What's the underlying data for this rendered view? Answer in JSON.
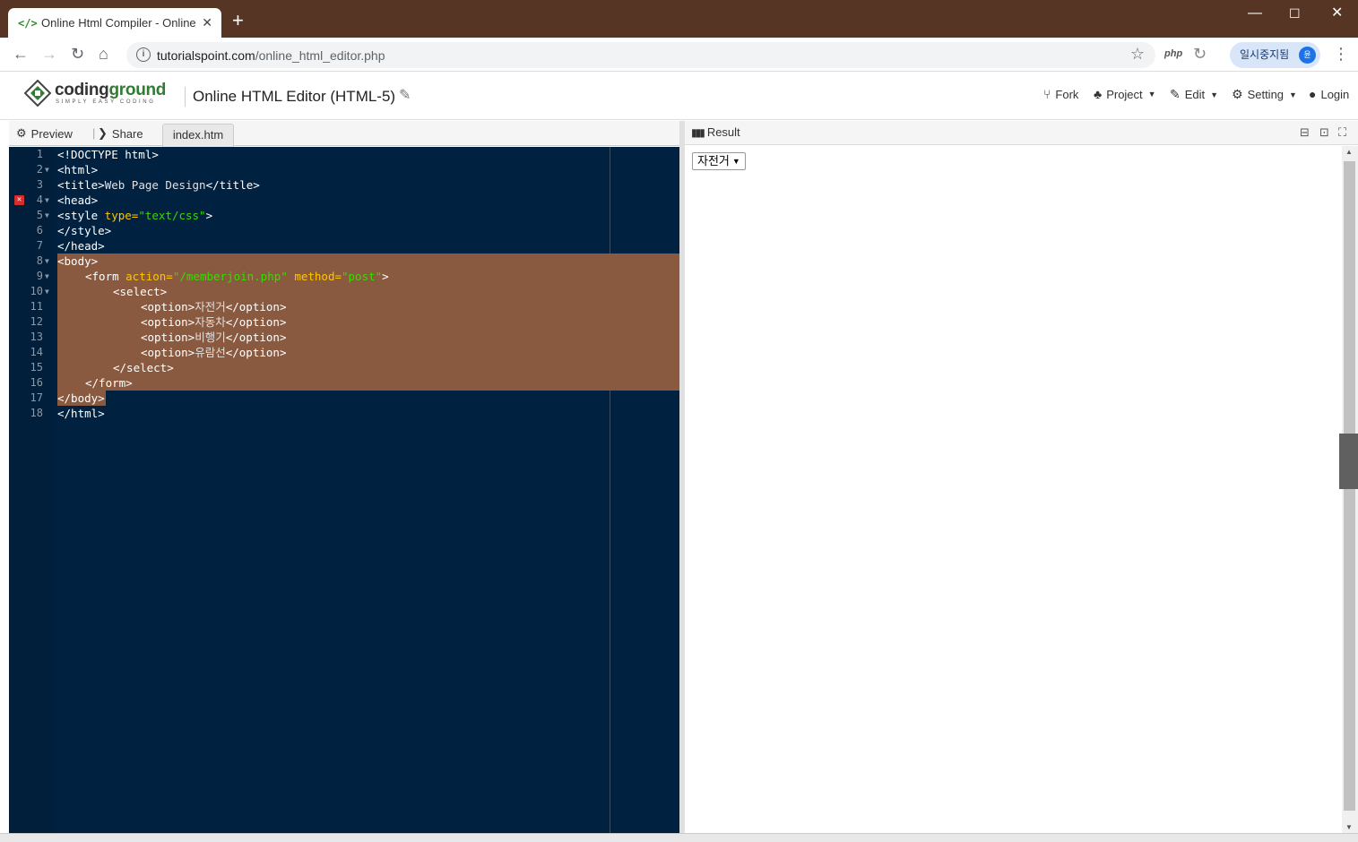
{
  "browser": {
    "tab_title": "Online Html Compiler - Online H",
    "tab_favicon": "</>",
    "url_host": "tutorialspoint.com",
    "url_path": "/online_html_editor.php",
    "extension_php": "php",
    "profile_label": "일시중지됨",
    "profile_avatar": "윤"
  },
  "site": {
    "logo_text_a": "coding",
    "logo_text_b": "ground",
    "logo_sub": "SIMPLY EASY CODING",
    "title": "Online HTML Editor (HTML-5)",
    "nav": {
      "fork": "Fork",
      "project": "Project",
      "edit": "Edit",
      "setting": "Setting",
      "login": "Login"
    }
  },
  "editor": {
    "preview_label": "Preview",
    "share_label": "Share",
    "file_tab": "index.htm",
    "lines": [
      {
        "n": "1",
        "fold": false,
        "error": false,
        "selected": false,
        "indent": 0,
        "tokens": [
          [
            "tag",
            "<!DOCTYPE html>"
          ]
        ]
      },
      {
        "n": "2",
        "fold": true,
        "error": false,
        "selected": false,
        "indent": 0,
        "tokens": [
          [
            "tag",
            "<html>"
          ]
        ]
      },
      {
        "n": "3",
        "fold": false,
        "error": false,
        "selected": false,
        "indent": 0,
        "tokens": [
          [
            "tag",
            "<title>"
          ],
          [
            "txt",
            "Web Page Design"
          ],
          [
            "tag",
            "</title>"
          ]
        ]
      },
      {
        "n": "4",
        "fold": true,
        "error": true,
        "selected": false,
        "indent": 0,
        "tokens": [
          [
            "tag",
            "<head>"
          ]
        ]
      },
      {
        "n": "5",
        "fold": true,
        "error": false,
        "selected": false,
        "indent": 0,
        "tokens": [
          [
            "tag",
            "<style "
          ],
          [
            "attr",
            "type="
          ],
          [
            "str",
            "\"text/css\""
          ],
          [
            "tag",
            ">"
          ]
        ]
      },
      {
        "n": "6",
        "fold": false,
        "error": false,
        "selected": false,
        "indent": 0,
        "tokens": [
          [
            "tag",
            "</style>"
          ]
        ]
      },
      {
        "n": "7",
        "fold": false,
        "error": false,
        "selected": false,
        "indent": 0,
        "tokens": [
          [
            "tag",
            "</head>"
          ]
        ]
      },
      {
        "n": "8",
        "fold": true,
        "error": false,
        "selected": true,
        "indent": 0,
        "tokens": [
          [
            "tag",
            "<body>"
          ]
        ]
      },
      {
        "n": "9",
        "fold": true,
        "error": false,
        "selected": true,
        "indent": 1,
        "tokens": [
          [
            "tag",
            "<form "
          ],
          [
            "attr",
            "action="
          ],
          [
            "str",
            "\"/memberjoin.php\""
          ],
          [
            "tag",
            " "
          ],
          [
            "attr",
            "method="
          ],
          [
            "str",
            "\"post\""
          ],
          [
            "tag",
            ">"
          ]
        ]
      },
      {
        "n": "10",
        "fold": true,
        "error": false,
        "selected": true,
        "indent": 2,
        "tokens": [
          [
            "tag",
            "<select>"
          ]
        ]
      },
      {
        "n": "11",
        "fold": false,
        "error": false,
        "selected": true,
        "indent": 3,
        "tokens": [
          [
            "tag",
            "<option>"
          ],
          [
            "txt",
            "자전거"
          ],
          [
            "tag",
            "</option>"
          ]
        ]
      },
      {
        "n": "12",
        "fold": false,
        "error": false,
        "selected": true,
        "indent": 3,
        "tokens": [
          [
            "tag",
            "<option>"
          ],
          [
            "txt",
            "자동차"
          ],
          [
            "tag",
            "</option>"
          ]
        ]
      },
      {
        "n": "13",
        "fold": false,
        "error": false,
        "selected": true,
        "indent": 3,
        "tokens": [
          [
            "tag",
            "<option>"
          ],
          [
            "txt",
            "비행기"
          ],
          [
            "tag",
            "</option>"
          ]
        ]
      },
      {
        "n": "14",
        "fold": false,
        "error": false,
        "selected": true,
        "indent": 3,
        "tokens": [
          [
            "tag",
            "<option>"
          ],
          [
            "txt",
            "유람선"
          ],
          [
            "tag",
            "</option>"
          ]
        ]
      },
      {
        "n": "15",
        "fold": false,
        "error": false,
        "selected": true,
        "indent": 2,
        "tokens": [
          [
            "tag",
            "</select>"
          ]
        ]
      },
      {
        "n": "16",
        "fold": false,
        "error": false,
        "selected": true,
        "indent": 1,
        "tokens": [
          [
            "tag",
            "</form>"
          ]
        ]
      },
      {
        "n": "17",
        "fold": false,
        "error": false,
        "selected": "partial",
        "indent": 0,
        "tokens": [
          [
            "tag",
            "</body>"
          ]
        ]
      },
      {
        "n": "18",
        "fold": false,
        "error": false,
        "selected": false,
        "indent": 0,
        "tokens": [
          [
            "tag",
            "</html>"
          ]
        ]
      }
    ]
  },
  "result": {
    "title": "Result",
    "select_value": "자전거"
  },
  "colors": {
    "titlebar": "#563525",
    "editor_bg": "#002240",
    "selection": "#8a5a40",
    "tag": "#ffffff",
    "attr": "#ffc600",
    "string": "#3ad900"
  }
}
